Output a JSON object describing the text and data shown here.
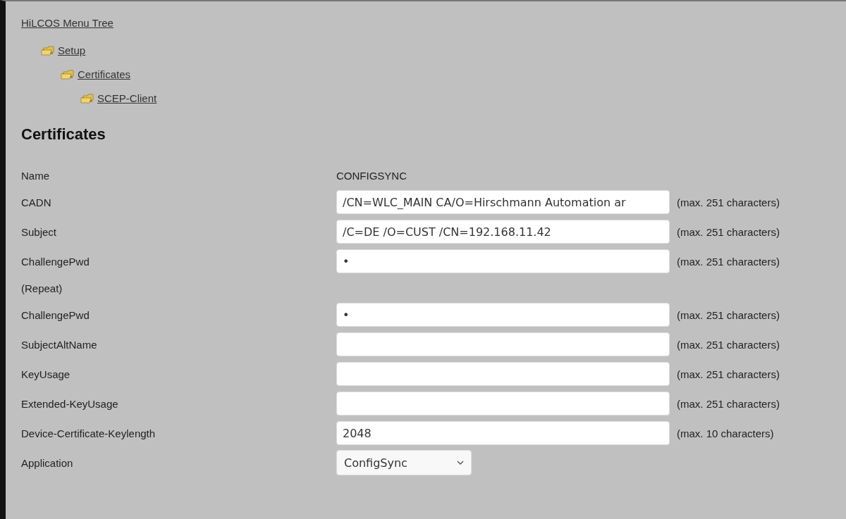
{
  "menu_tree": {
    "title": "HiLCOS Menu Tree",
    "items": [
      {
        "label": "Setup",
        "children": [
          {
            "label": "Certificates",
            "children": [
              {
                "label": "SCEP-Client"
              }
            ]
          }
        ]
      }
    ]
  },
  "heading": "Certificates",
  "rows": [
    {
      "kind": "text",
      "label": "Name",
      "value": "CONFIGSYNC"
    },
    {
      "kind": "input",
      "label": "CADN",
      "value": "/CN=WLC_MAIN CA/O=Hirschmann Automation ar",
      "hint": "(max. 251 characters)"
    },
    {
      "kind": "input",
      "label": "Subject",
      "value": "/C=DE /O=CUST /CN=192.168.11.42",
      "hint": "(max. 251 characters)"
    },
    {
      "kind": "input",
      "label": "ChallengePwd",
      "value": "•",
      "hint": "(max. 251 characters)"
    },
    {
      "kind": "label",
      "label": "(Repeat)"
    },
    {
      "kind": "input",
      "label": "ChallengePwd",
      "value": "•",
      "hint": "(max. 251 characters)"
    },
    {
      "kind": "input",
      "label": "SubjectAltName",
      "hint": "(max. 251 characters)"
    },
    {
      "kind": "input",
      "label": "KeyUsage",
      "hint": "(max. 251 characters)"
    },
    {
      "kind": "input",
      "label": "Extended-KeyUsage",
      "hint": "(max. 251 characters)"
    },
    {
      "kind": "input",
      "label": "Device-Certificate-Keylength",
      "value": "2048",
      "hint": "(max. 10 characters)"
    },
    {
      "kind": "select",
      "label": "Application",
      "value": "ConfigSync"
    }
  ]
}
